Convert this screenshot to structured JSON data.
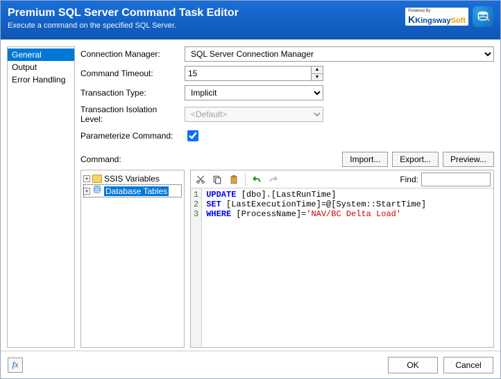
{
  "header": {
    "title": "Premium SQL Server Command Task Editor",
    "subtitle": "Execute a command on the specified SQL Server.",
    "powered_by": "Powered By",
    "brand_a": "Kingsway",
    "brand_b": "Soft"
  },
  "nav": {
    "items": [
      {
        "label": "General",
        "selected": true
      },
      {
        "label": "Output",
        "selected": false
      },
      {
        "label": "Error Handling",
        "selected": false
      }
    ]
  },
  "form": {
    "connection_label": "Connection Manager:",
    "connection_value": "SQL Server Connection Manager",
    "timeout_label": "Command Timeout:",
    "timeout_value": "15",
    "txn_type_label": "Transaction Type:",
    "txn_type_value": "Implicit",
    "iso_label": "Transaction Isolation Level:",
    "iso_value": "<Default>",
    "param_label": "Parameterize Command:",
    "param_checked": true
  },
  "command": {
    "label": "Command:",
    "import": "Import...",
    "export": "Export...",
    "preview": "Preview..."
  },
  "tree": {
    "items": [
      {
        "label": "SSIS Variables",
        "icon": "folder",
        "selected": false
      },
      {
        "label": "Database Tables",
        "icon": "db",
        "selected": true
      }
    ]
  },
  "toolbar": {
    "find_label": "Find:",
    "find_value": ""
  },
  "code": {
    "lines": [
      {
        "n": "1",
        "kw": "UPDATE",
        "rest": " [dbo].[LastRunTime]"
      },
      {
        "n": "2",
        "kw": "SET",
        "rest": " [LastExecutionTime]=@[System::StartTime]"
      },
      {
        "n": "3",
        "kw": "WHERE",
        "rest": " [ProcessName]=",
        "str": "'NAV/BC Delta Load'"
      }
    ]
  },
  "footer": {
    "fx": "fx",
    "ok": "OK",
    "cancel": "Cancel"
  }
}
